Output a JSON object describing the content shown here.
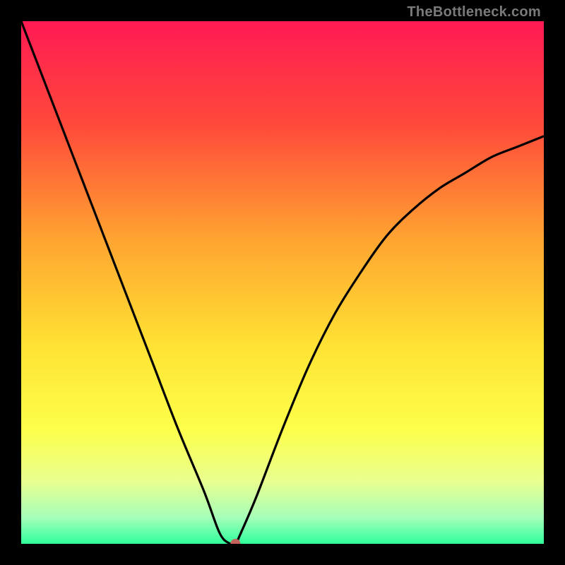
{
  "watermark": {
    "text": "TheBottleneck.com"
  },
  "chart_data": {
    "type": "line",
    "title": "",
    "xlabel": "",
    "ylabel": "",
    "xlim": [
      0,
      100
    ],
    "ylim": [
      0,
      100
    ],
    "gradient_stops": [
      {
        "offset": 0,
        "color": "#ff1a54"
      },
      {
        "offset": 20,
        "color": "#ff4a3a"
      },
      {
        "offset": 42,
        "color": "#ffa531"
      },
      {
        "offset": 62,
        "color": "#ffe233"
      },
      {
        "offset": 78,
        "color": "#fdff4a"
      },
      {
        "offset": 88,
        "color": "#e9ff8f"
      },
      {
        "offset": 95,
        "color": "#a5ffb9"
      },
      {
        "offset": 100,
        "color": "#2fff9c"
      }
    ],
    "series": [
      {
        "name": "bottleneck-curve",
        "x": [
          0,
          5,
          10,
          15,
          20,
          25,
          30,
          35,
          38,
          40,
          41,
          42,
          45,
          50,
          55,
          60,
          65,
          70,
          75,
          80,
          85,
          90,
          95,
          100
        ],
        "y": [
          100,
          87,
          74,
          61,
          48,
          35,
          22,
          10,
          2,
          0,
          0,
          2,
          9,
          22,
          34,
          44,
          52,
          59,
          64,
          68,
          71,
          74,
          76,
          78
        ]
      }
    ],
    "marker": {
      "x": 41,
      "y": 0,
      "color": "#c4635c",
      "radius": 7
    }
  }
}
